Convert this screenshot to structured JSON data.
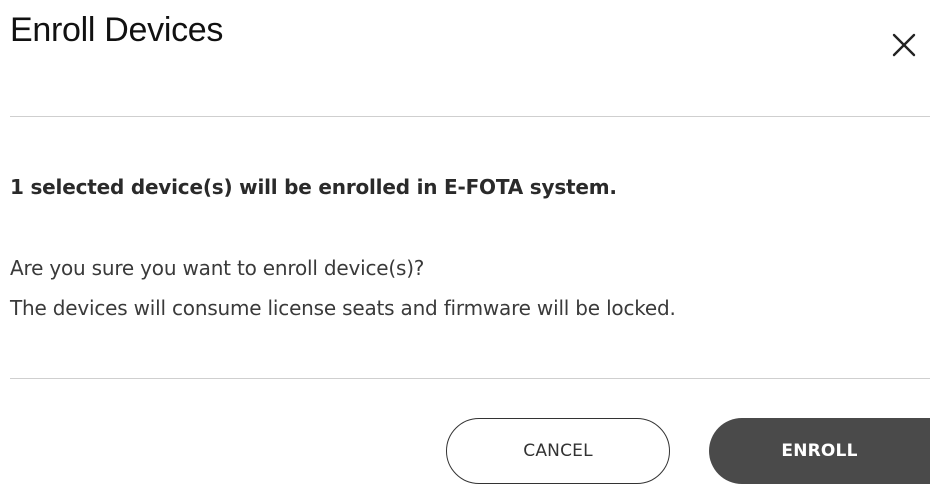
{
  "dialog": {
    "title": "Enroll Devices",
    "close_icon": "close-icon",
    "message_bold": "1 selected device(s) will be enrolled in E-FOTA system.",
    "message_line_1": "Are you sure you want to enroll device(s)?",
    "message_line_2": "The devices will consume license seats and firmware will be locked.",
    "cancel_label": "CANCEL",
    "enroll_label": "ENROLL"
  },
  "colors": {
    "primary_button_bg": "#4a4a4a",
    "primary_button_text": "#ffffff",
    "secondary_button_border": "#333333",
    "divider": "#cfcfcf",
    "title_text": "#111111"
  }
}
